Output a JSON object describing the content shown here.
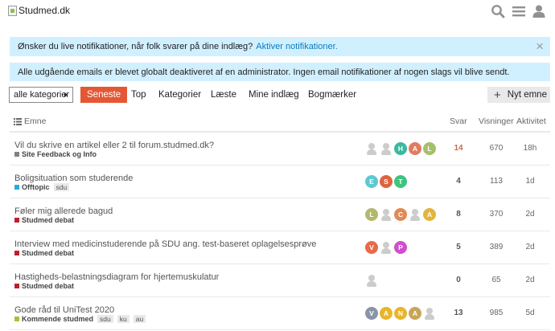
{
  "header": {
    "logo_alt": "Studmed.dk",
    "search_icon": "search-icon",
    "menu_icon": "hamburger-icon",
    "user_icon": "user-icon"
  },
  "banners": {
    "notify_text": "Ønsker du live notifikationer, når folk svarer på dine indlæg?",
    "notify_link": "Aktiver notifikationer.",
    "close": "×",
    "email_text": "Alle udgående emails er blevet globalt deaktiveret af en administrator. Ingen email notifikationer af nogen slags vil blive sendt."
  },
  "nav": {
    "category_dropdown": "alle kategorier",
    "tabs": [
      "Seneste",
      "Top",
      "Kategorier",
      "Læste",
      "Mine indlæg",
      "Bogmærker"
    ],
    "new_topic": "Nyt emne"
  },
  "table_header": {
    "topic": "Emne",
    "replies": "Svar",
    "views": "Visninger",
    "activity": "Aktivitet"
  },
  "colors": {
    "accent": "#e45735",
    "banner_bg": "#d1f0ff",
    "link": "#0a7bc1"
  },
  "topics": [
    {
      "title": "Vil du skrive en artikel eller 2 til forum.studmed.dk?",
      "category": "Site Feedback og Info",
      "category_color": "#808281",
      "tags": [],
      "avatars": [
        {
          "letter": "",
          "color": ""
        },
        {
          "letter": "",
          "color": ""
        },
        {
          "letter": "H",
          "color": "#3ab99e"
        },
        {
          "letter": "A",
          "color": "#e27b5e"
        },
        {
          "letter": "L",
          "color": "#a6c06a"
        }
      ],
      "replies": "14",
      "hot": true,
      "views": "670",
      "activity": "18h"
    },
    {
      "title": "Boligsituation som studerende",
      "category": "Offtopic",
      "category_color": "#25aae2",
      "tags": [
        "sdu"
      ],
      "avatars": [
        {
          "letter": "E",
          "color": "#5ec8d0"
        },
        {
          "letter": "S",
          "color": "#dd6340"
        },
        {
          "letter": "T",
          "color": "#3dc47e"
        }
      ],
      "replies": "4",
      "hot": false,
      "views": "113",
      "activity": "1d"
    },
    {
      "title": "Føler mig allerede bagud",
      "category": "Studmed debat",
      "category_color": "#bf1e2e",
      "tags": [],
      "avatars": [
        {
          "letter": "L",
          "color": "#b3b86d"
        },
        {
          "letter": "",
          "color": ""
        },
        {
          "letter": "C",
          "color": "#e08b55"
        },
        {
          "letter": "",
          "color": ""
        },
        {
          "letter": "A",
          "color": "#e3b53b"
        }
      ],
      "replies": "8",
      "hot": false,
      "views": "370",
      "activity": "2d"
    },
    {
      "title": "Interview med medicinstuderende på SDU ang. test-baseret oplagelsesprøve",
      "category": "Studmed debat",
      "category_color": "#bf1e2e",
      "tags": [],
      "avatars": [
        {
          "letter": "V",
          "color": "#e86a4a"
        },
        {
          "letter": "",
          "color": ""
        },
        {
          "letter": "P",
          "color": "#cf4fcf"
        }
      ],
      "replies": "5",
      "hot": false,
      "views": "389",
      "activity": "2d"
    },
    {
      "title": "Hastigheds-belastningsdiagram for hjertemuskulatur",
      "category": "Studmed debat",
      "category_color": "#bf1e2e",
      "tags": [],
      "avatars": [
        {
          "letter": "",
          "color": ""
        }
      ],
      "replies": "0",
      "hot": false,
      "views": "65",
      "activity": "2d"
    },
    {
      "title": "Gode råd til UniTest 2020",
      "category": "Kommende studmed",
      "category_color": "#a1c435",
      "tags": [
        "sdu",
        "ku",
        "au"
      ],
      "avatars": [
        {
          "letter": "V",
          "color": "#8a94a8"
        },
        {
          "letter": "A",
          "color": "#e8b52b"
        },
        {
          "letter": "N",
          "color": "#e8b52b"
        },
        {
          "letter": "A",
          "color": "#c7a65a"
        },
        {
          "letter": "",
          "color": ""
        }
      ],
      "replies": "13",
      "hot": false,
      "views": "985",
      "activity": "5d"
    }
  ]
}
